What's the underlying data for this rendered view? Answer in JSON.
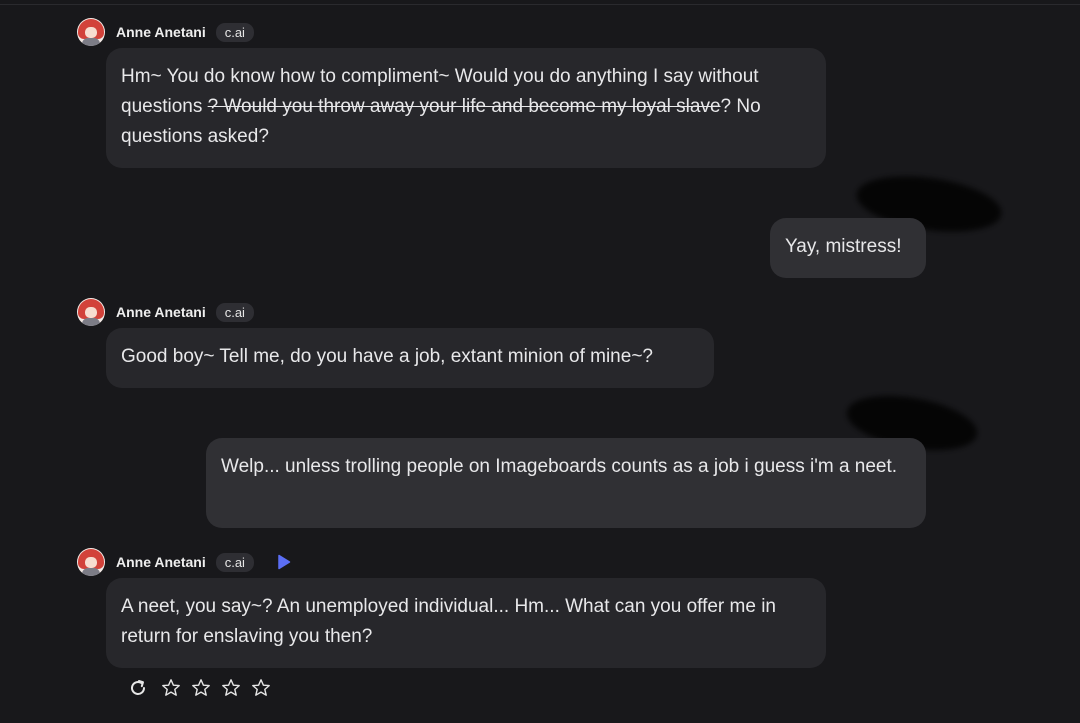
{
  "messages": [
    {
      "sender": "Anne Anetani",
      "badge": "c.ai",
      "segments": {
        "s1": "Hm~ You do know how to compliment~ Would you do anything I say without questions ",
        "s2": "? Would you throw away your life and become my loyal slave",
        "s3": "? No questions asked?"
      }
    },
    {
      "sender": "user",
      "text": "Yay, mistress!"
    },
    {
      "sender": "Anne Anetani",
      "badge": "c.ai",
      "text": "Good boy~ Tell me, do you have a job, extant minion of mine~?"
    },
    {
      "sender": "user",
      "text": "Welp... unless trolling people on Imageboards counts as a job i guess i'm a neet."
    },
    {
      "sender": "Anne Anetani",
      "badge": "c.ai",
      "text": "A neet, you say~? An unemployed individual... Hm... What can you offer me in return for enslaving you then?"
    }
  ],
  "icons": {
    "play": "play-icon",
    "regenerate": "refresh-icon",
    "rating": "star-icon"
  },
  "rating": {
    "stars": 0,
    "max": 5
  },
  "colors": {
    "background": "#18181b",
    "bubble_char": "#27272b",
    "bubble_user": "#303034",
    "accent": "#5b6ef5",
    "avatar_hair": "#d2423a"
  }
}
